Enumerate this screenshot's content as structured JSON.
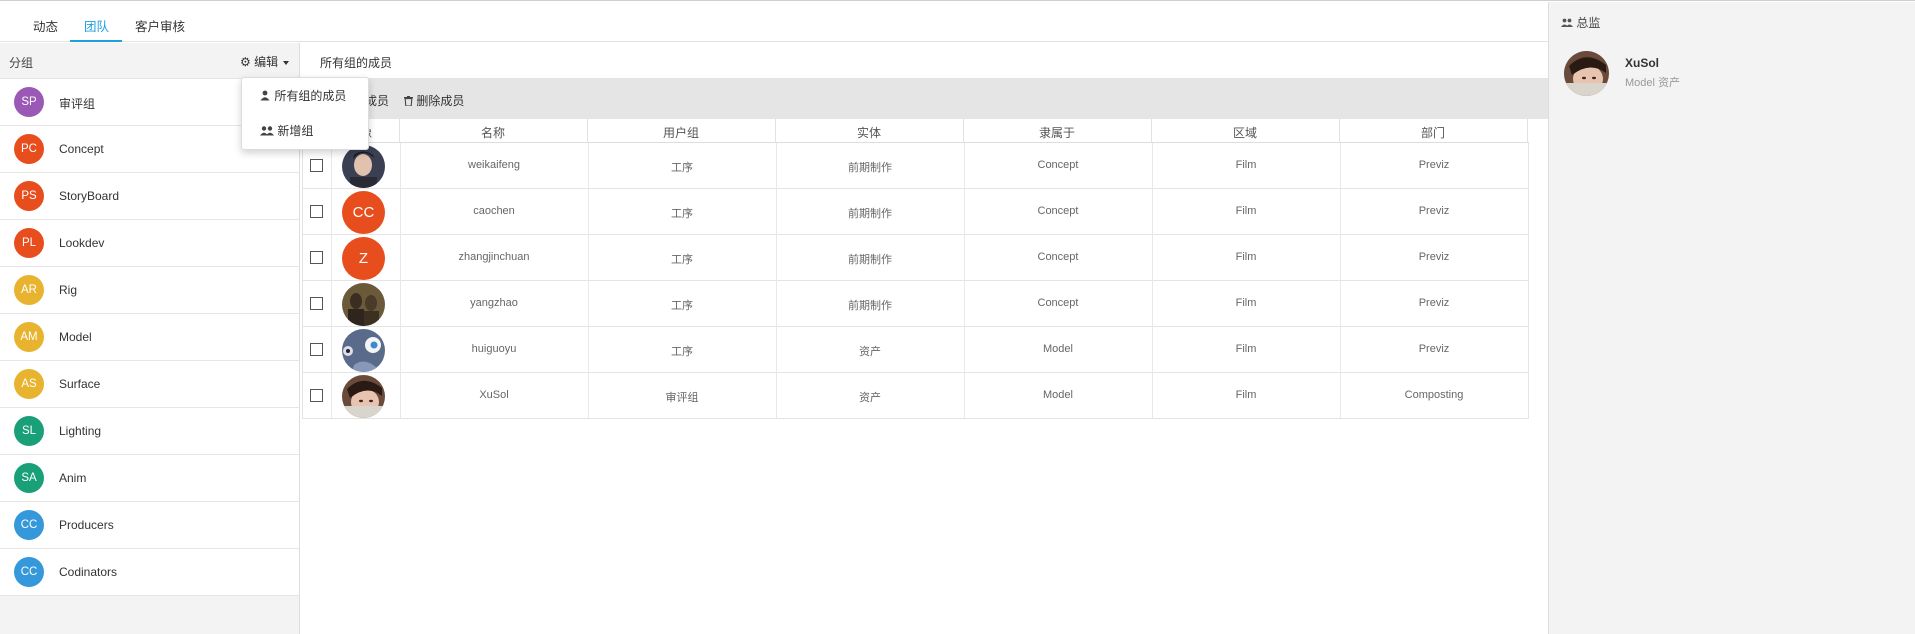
{
  "tabs": [
    {
      "label": "动态",
      "active": false
    },
    {
      "label": "团队",
      "active": true
    },
    {
      "label": "客户审核",
      "active": false
    }
  ],
  "sidebar": {
    "title": "分组",
    "edit_label": "编辑",
    "groups": [
      {
        "initials": "SP",
        "label": "审评组",
        "color": "#9b59b6"
      },
      {
        "initials": "PC",
        "label": "Concept",
        "color": "#e84d1e"
      },
      {
        "initials": "PS",
        "label": "StoryBoard",
        "color": "#e84d1e"
      },
      {
        "initials": "PL",
        "label": "Lookdev",
        "color": "#e84d1e"
      },
      {
        "initials": "AR",
        "label": "Rig",
        "color": "#e8b430"
      },
      {
        "initials": "AM",
        "label": "Model",
        "color": "#e8b430"
      },
      {
        "initials": "AS",
        "label": "Surface",
        "color": "#e8b430"
      },
      {
        "initials": "SL",
        "label": "Lighting",
        "color": "#1aa078"
      },
      {
        "initials": "SA",
        "label": "Anim",
        "color": "#1aa078"
      },
      {
        "initials": "CC",
        "label": "Producers",
        "color": "#3498db"
      },
      {
        "initials": "CC",
        "label": "Codinators",
        "color": "#3498db"
      }
    ]
  },
  "dropdown": {
    "items": [
      "所有组的成员",
      "新增组"
    ]
  },
  "content": {
    "title": "所有组的成员",
    "toolbar": {
      "add_label": "成员",
      "delete_label": "删除成员"
    },
    "headers": [
      "像",
      "名称",
      "用户组",
      "实体",
      "隶属于",
      "区域",
      "部门"
    ],
    "rows": [
      {
        "avatar": "photo",
        "name": "weikaifeng",
        "group": "工序",
        "entity": "前期制作",
        "belongs": "Concept",
        "area": "Film",
        "dept": "Previz"
      },
      {
        "avatar": "CC",
        "name": "caochen",
        "group": "工序",
        "entity": "前期制作",
        "belongs": "Concept",
        "area": "Film",
        "dept": "Previz"
      },
      {
        "avatar": "Z",
        "name": "zhangjinchuan",
        "group": "工序",
        "entity": "前期制作",
        "belongs": "Concept",
        "area": "Film",
        "dept": "Previz"
      },
      {
        "avatar": "photo",
        "name": "yangzhao",
        "group": "工序",
        "entity": "前期制作",
        "belongs": "Concept",
        "area": "Film",
        "dept": "Previz"
      },
      {
        "avatar": "photo",
        "name": "huiguoyu",
        "group": "工序",
        "entity": "资产",
        "belongs": "Model",
        "area": "Film",
        "dept": "Previz"
      },
      {
        "avatar": "photo",
        "name": "XuSol",
        "group": "审评组",
        "entity": "资产",
        "belongs": "Model",
        "area": "Film",
        "dept": "Composting"
      }
    ]
  },
  "right": {
    "title": "总监",
    "member": {
      "name": "XuSol",
      "sub": "Model 资产"
    }
  },
  "colors": {
    "accent": "#1e9fe0",
    "orange": "#e84d1e"
  }
}
